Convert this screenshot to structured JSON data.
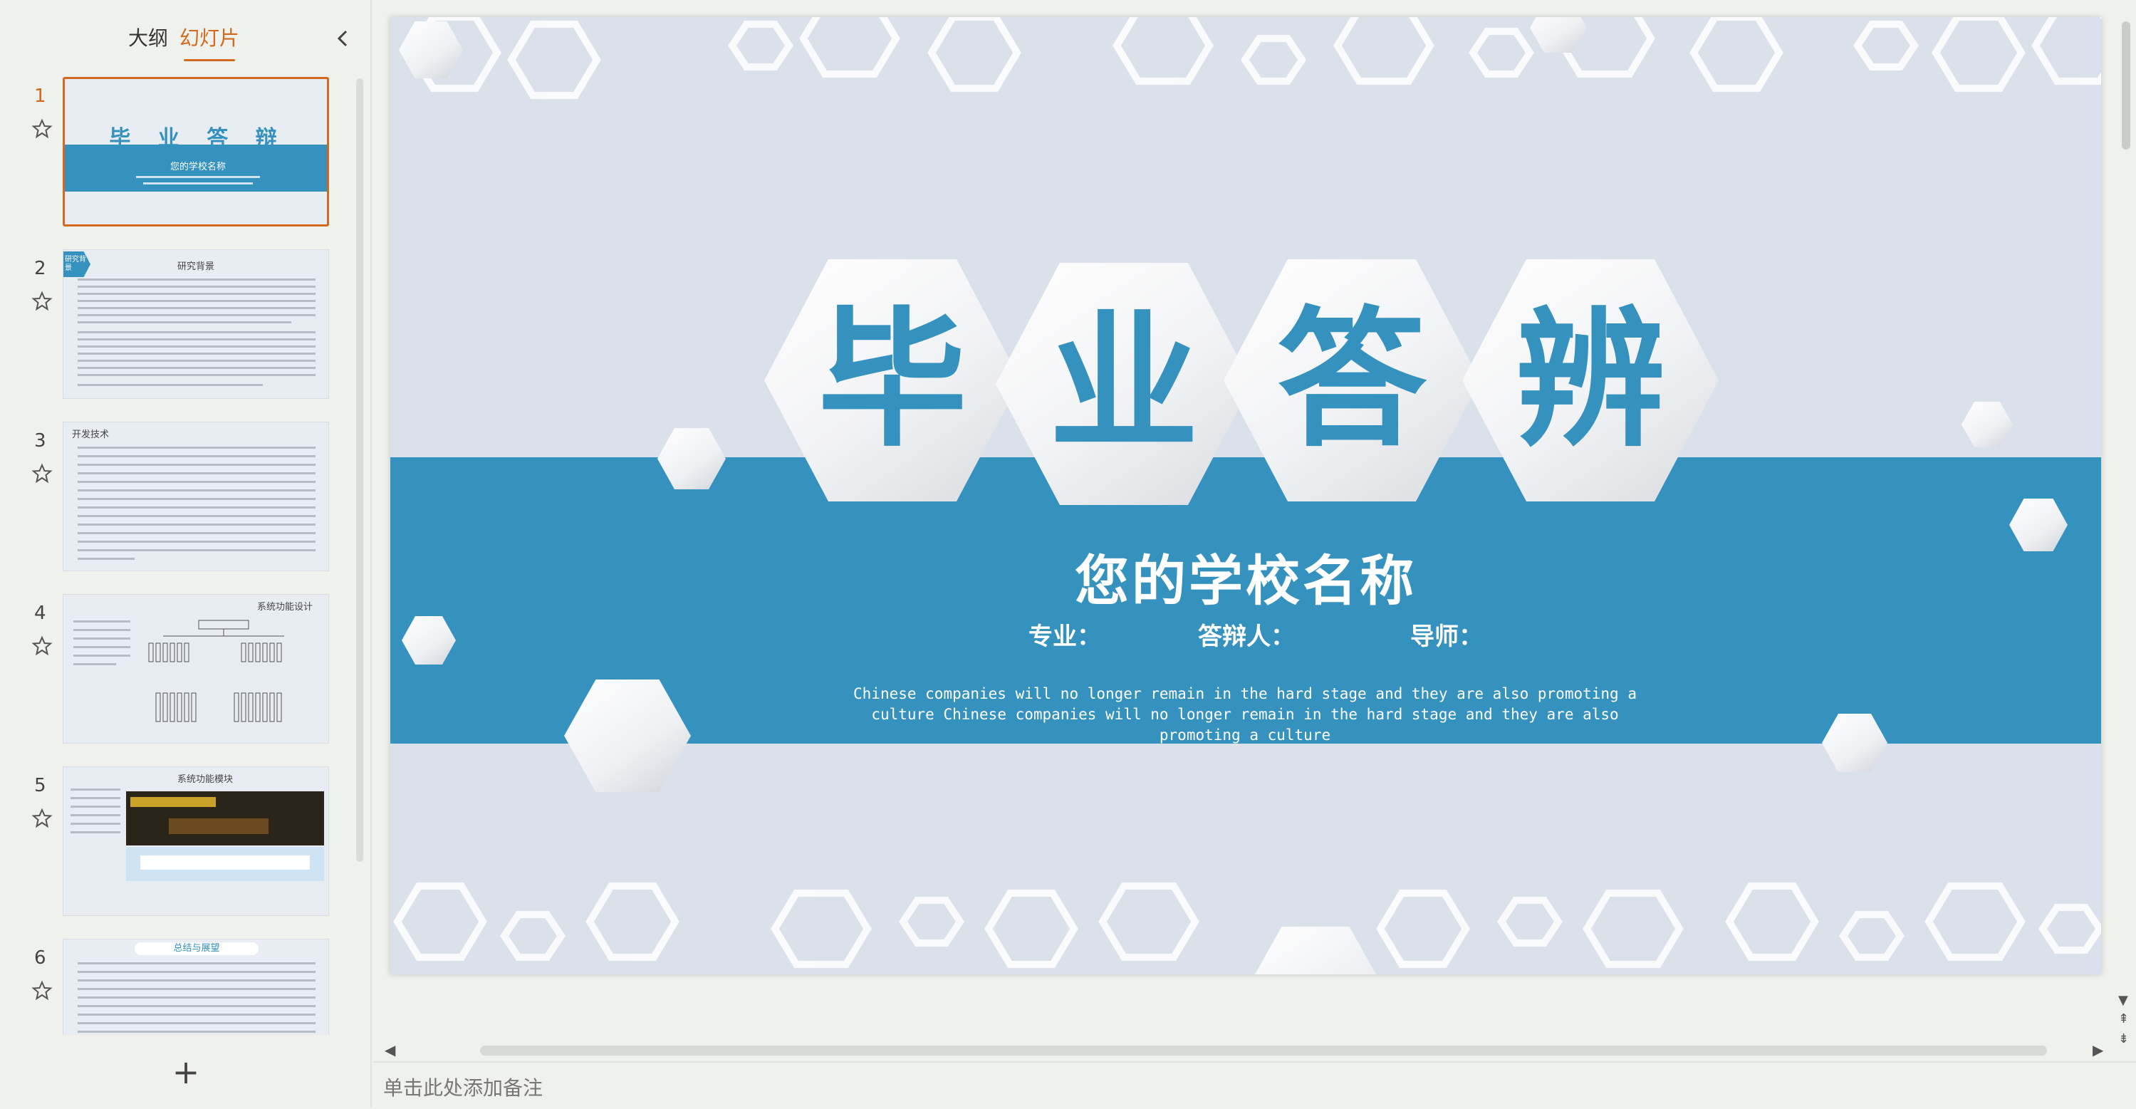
{
  "panel": {
    "tabs": [
      "大纲",
      "幻灯片"
    ],
    "active_tab": "幻灯片",
    "collapse_icon": "chevron-left-icon",
    "add_icon": "plus-icon"
  },
  "thumbnails": [
    {
      "num": "1",
      "title": "毕 业 答 辩",
      "subtitle": "您的学校名称",
      "active": true
    },
    {
      "num": "2",
      "title": "研究背景",
      "tag": "研究背景"
    },
    {
      "num": "3",
      "title": "开发技术"
    },
    {
      "num": "4",
      "title": "系统功能设计"
    },
    {
      "num": "5",
      "title": "系统功能模块"
    },
    {
      "num": "6",
      "title": "总结与展望"
    }
  ],
  "slide": {
    "title_chars": [
      "毕",
      "业",
      "答",
      "辨"
    ],
    "school": "您的学校名称",
    "info": {
      "major": "专业：",
      "defender": "答辩人：",
      "advisor": "导师："
    },
    "english": "Chinese  companies  will no longer remain in the hard stage and they are also promoting a culture Chinese  companies will no longer remain in the hard stage and they are also promoting a culture"
  },
  "notes_placeholder": "单击此处添加备注",
  "colors": {
    "accent": "#d2691e",
    "band": "#3591bd",
    "slide_bg": "#dbe1eb"
  }
}
